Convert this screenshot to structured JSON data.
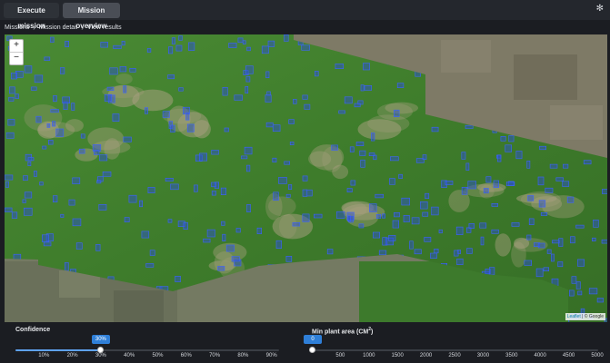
{
  "tabs": [
    {
      "label": "Execute mission",
      "active": false
    },
    {
      "label": "Mission overview",
      "active": true
    }
  ],
  "settings_icon": "gear-icon",
  "breadcrumb": [
    "Missions",
    "Mission detail",
    "View results"
  ],
  "map": {
    "zoom_in": "+",
    "zoom_out": "−",
    "attribution_leaflet": "Leaflet",
    "attribution_sep": " | © ",
    "attribution_provider": "Google"
  },
  "controls": {
    "confidence": {
      "label": "Confidence",
      "value_label": "30%",
      "value": 0.3,
      "ticks": [
        "10%",
        "20%",
        "30%",
        "40%",
        "50%",
        "60%",
        "70%",
        "80%",
        "90%"
      ]
    },
    "min_area": {
      "label": "Min plant area (CM",
      "label_sup": "2",
      "label_end": ")",
      "value_label": "0",
      "value": 0,
      "ticks": [
        "500",
        "1000",
        "1500",
        "2000",
        "2500",
        "3000",
        "3500",
        "4000",
        "4500",
        "5000"
      ]
    }
  },
  "colors": {
    "accent": "#2f7fd8",
    "detection": "#2a4fd6",
    "grass": "#3f7a2a"
  }
}
